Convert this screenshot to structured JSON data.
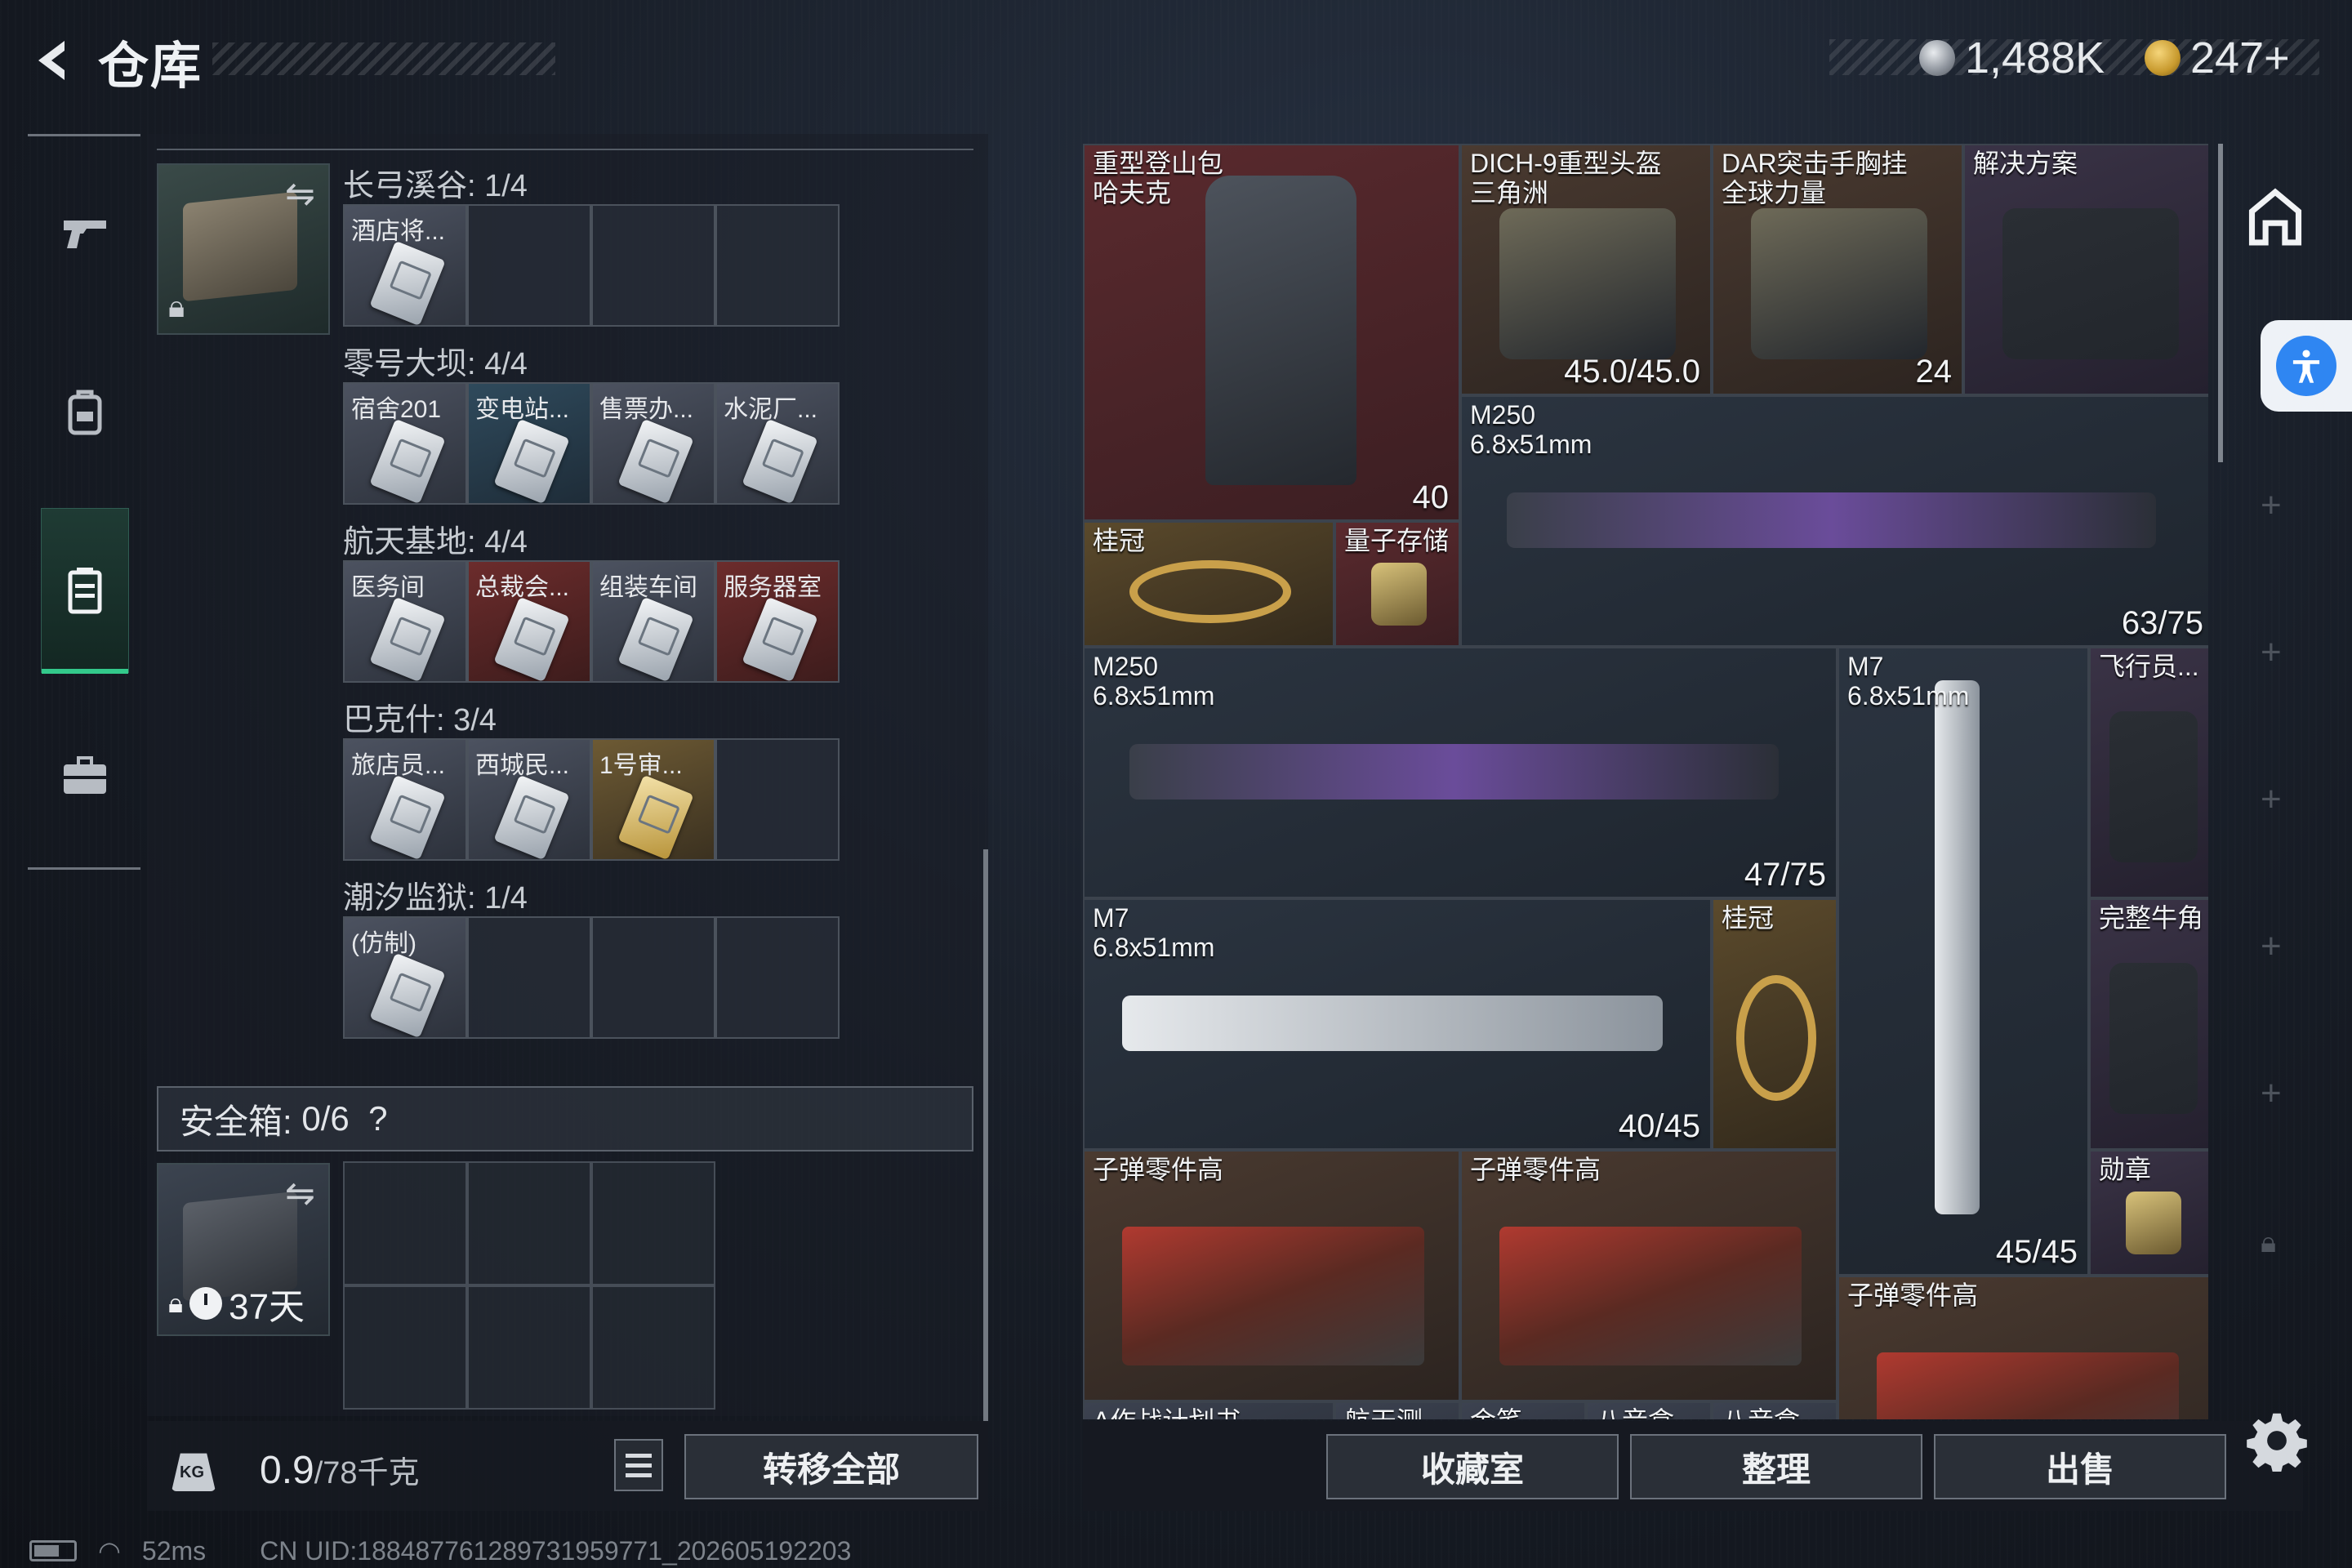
{
  "header": {
    "title": "仓库",
    "currency": [
      {
        "icon": "silver-coin-icon",
        "value": "1,488K"
      },
      {
        "icon": "gold-coin-icon",
        "value": "247+"
      }
    ]
  },
  "nav": [
    {
      "icon": "pistol-icon"
    },
    {
      "icon": "backpack-icon"
    },
    {
      "icon": "storage-icon",
      "active": true
    },
    {
      "icon": "briefcase-icon"
    }
  ],
  "keys": {
    "regions": [
      {
        "label": "长弓溪谷: 1/4",
        "cells": [
          {
            "name": "酒店将...",
            "tone": "t-gray"
          },
          null,
          null,
          null
        ]
      },
      {
        "label": "零号大坝: 4/4",
        "cells": [
          {
            "name": "宿舍201",
            "tone": "t-gray"
          },
          {
            "name": "变电站...",
            "tone": "t-blue"
          },
          {
            "name": "售票办...",
            "tone": "t-gray"
          },
          {
            "name": "水泥厂...",
            "tone": "t-gray"
          }
        ]
      },
      {
        "label": "航天基地: 4/4",
        "cells": [
          {
            "name": "医务间",
            "tone": "t-gray"
          },
          {
            "name": "总裁会...",
            "tone": "t-red"
          },
          {
            "name": "组装车间",
            "tone": "t-gray"
          },
          {
            "name": "服务器室",
            "tone": "t-red"
          }
        ]
      },
      {
        "label": "巴克什: 3/4",
        "cells": [
          {
            "name": "旅店员...",
            "tone": "t-gray"
          },
          {
            "name": "西城民...",
            "tone": "t-gray"
          },
          {
            "name": "1号审...",
            "tone": "t-gold"
          },
          null
        ]
      },
      {
        "label": "潮汐监狱: 1/4",
        "cells": [
          {
            "name": "(仿制)",
            "tone": "t-gray"
          },
          null,
          null,
          null
        ]
      }
    ]
  },
  "safe_box": {
    "label": "安全箱:",
    "value": "0/6",
    "help": "?",
    "timer": "37天"
  },
  "footer_left": {
    "weight": "0.9",
    "weight_unit": "/78千克",
    "kg_label": "KG",
    "transfer_all": "转移全部"
  },
  "status_bar": {
    "ping": "52ms",
    "uid": "CN UID:18848776128973195977​1_202605192203"
  },
  "stash_items": [
    {
      "name": "重型登山包\n哈夫克",
      "tone": "red",
      "count": "40",
      "count_icon": "backpack-small-icon"
    },
    {
      "name": "DICH-9重型头盔\n三角洲",
      "tone": "brown",
      "count": "45.0/45.0"
    },
    {
      "name": "DAR突击手胸挂\n全球力量",
      "tone": "brown",
      "count": "24",
      "count_icon": "vest-small-icon"
    },
    {
      "name": "解决方案",
      "tone": "purple"
    },
    {
      "name": "M250\n6.8x51mm",
      "tone": "dark",
      "count": "63/75"
    },
    {
      "name": "桂冠",
      "tone": "gold"
    },
    {
      "name": "量子存储",
      "tone": "red"
    },
    {
      "name": "M250\n6.8x51mm",
      "tone": "dark",
      "count": "47/75"
    },
    {
      "name": "M7\n6.8x51mm",
      "tone": "dark",
      "count": "45/45"
    },
    {
      "name": "飞行员...",
      "tone": "purple"
    },
    {
      "name": "M7\n6.8x51mm",
      "tone": "dark",
      "count": "40/45"
    },
    {
      "name": "桂冠",
      "tone": "gold"
    },
    {
      "name": "完整牛角",
      "tone": "purple"
    },
    {
      "name": "子弹零件高",
      "tone": "brown"
    },
    {
      "name": "子弹零件高",
      "tone": "brown"
    },
    {
      "name": "勋章",
      "tone": "purple"
    },
    {
      "name": "子弹零件高",
      "tone": "brown"
    },
    {
      "name": "A作战计划书",
      "tone": "gray"
    },
    {
      "name": "航天测...",
      "tone": "gray"
    },
    {
      "name": "金笔",
      "tone": "gray"
    },
    {
      "name": "八音盒",
      "tone": "gray"
    },
    {
      "name": "八音盒",
      "tone": "gray"
    }
  ],
  "footer_right": {
    "collection": "收藏室",
    "organize": "整理",
    "sell": "出售"
  }
}
